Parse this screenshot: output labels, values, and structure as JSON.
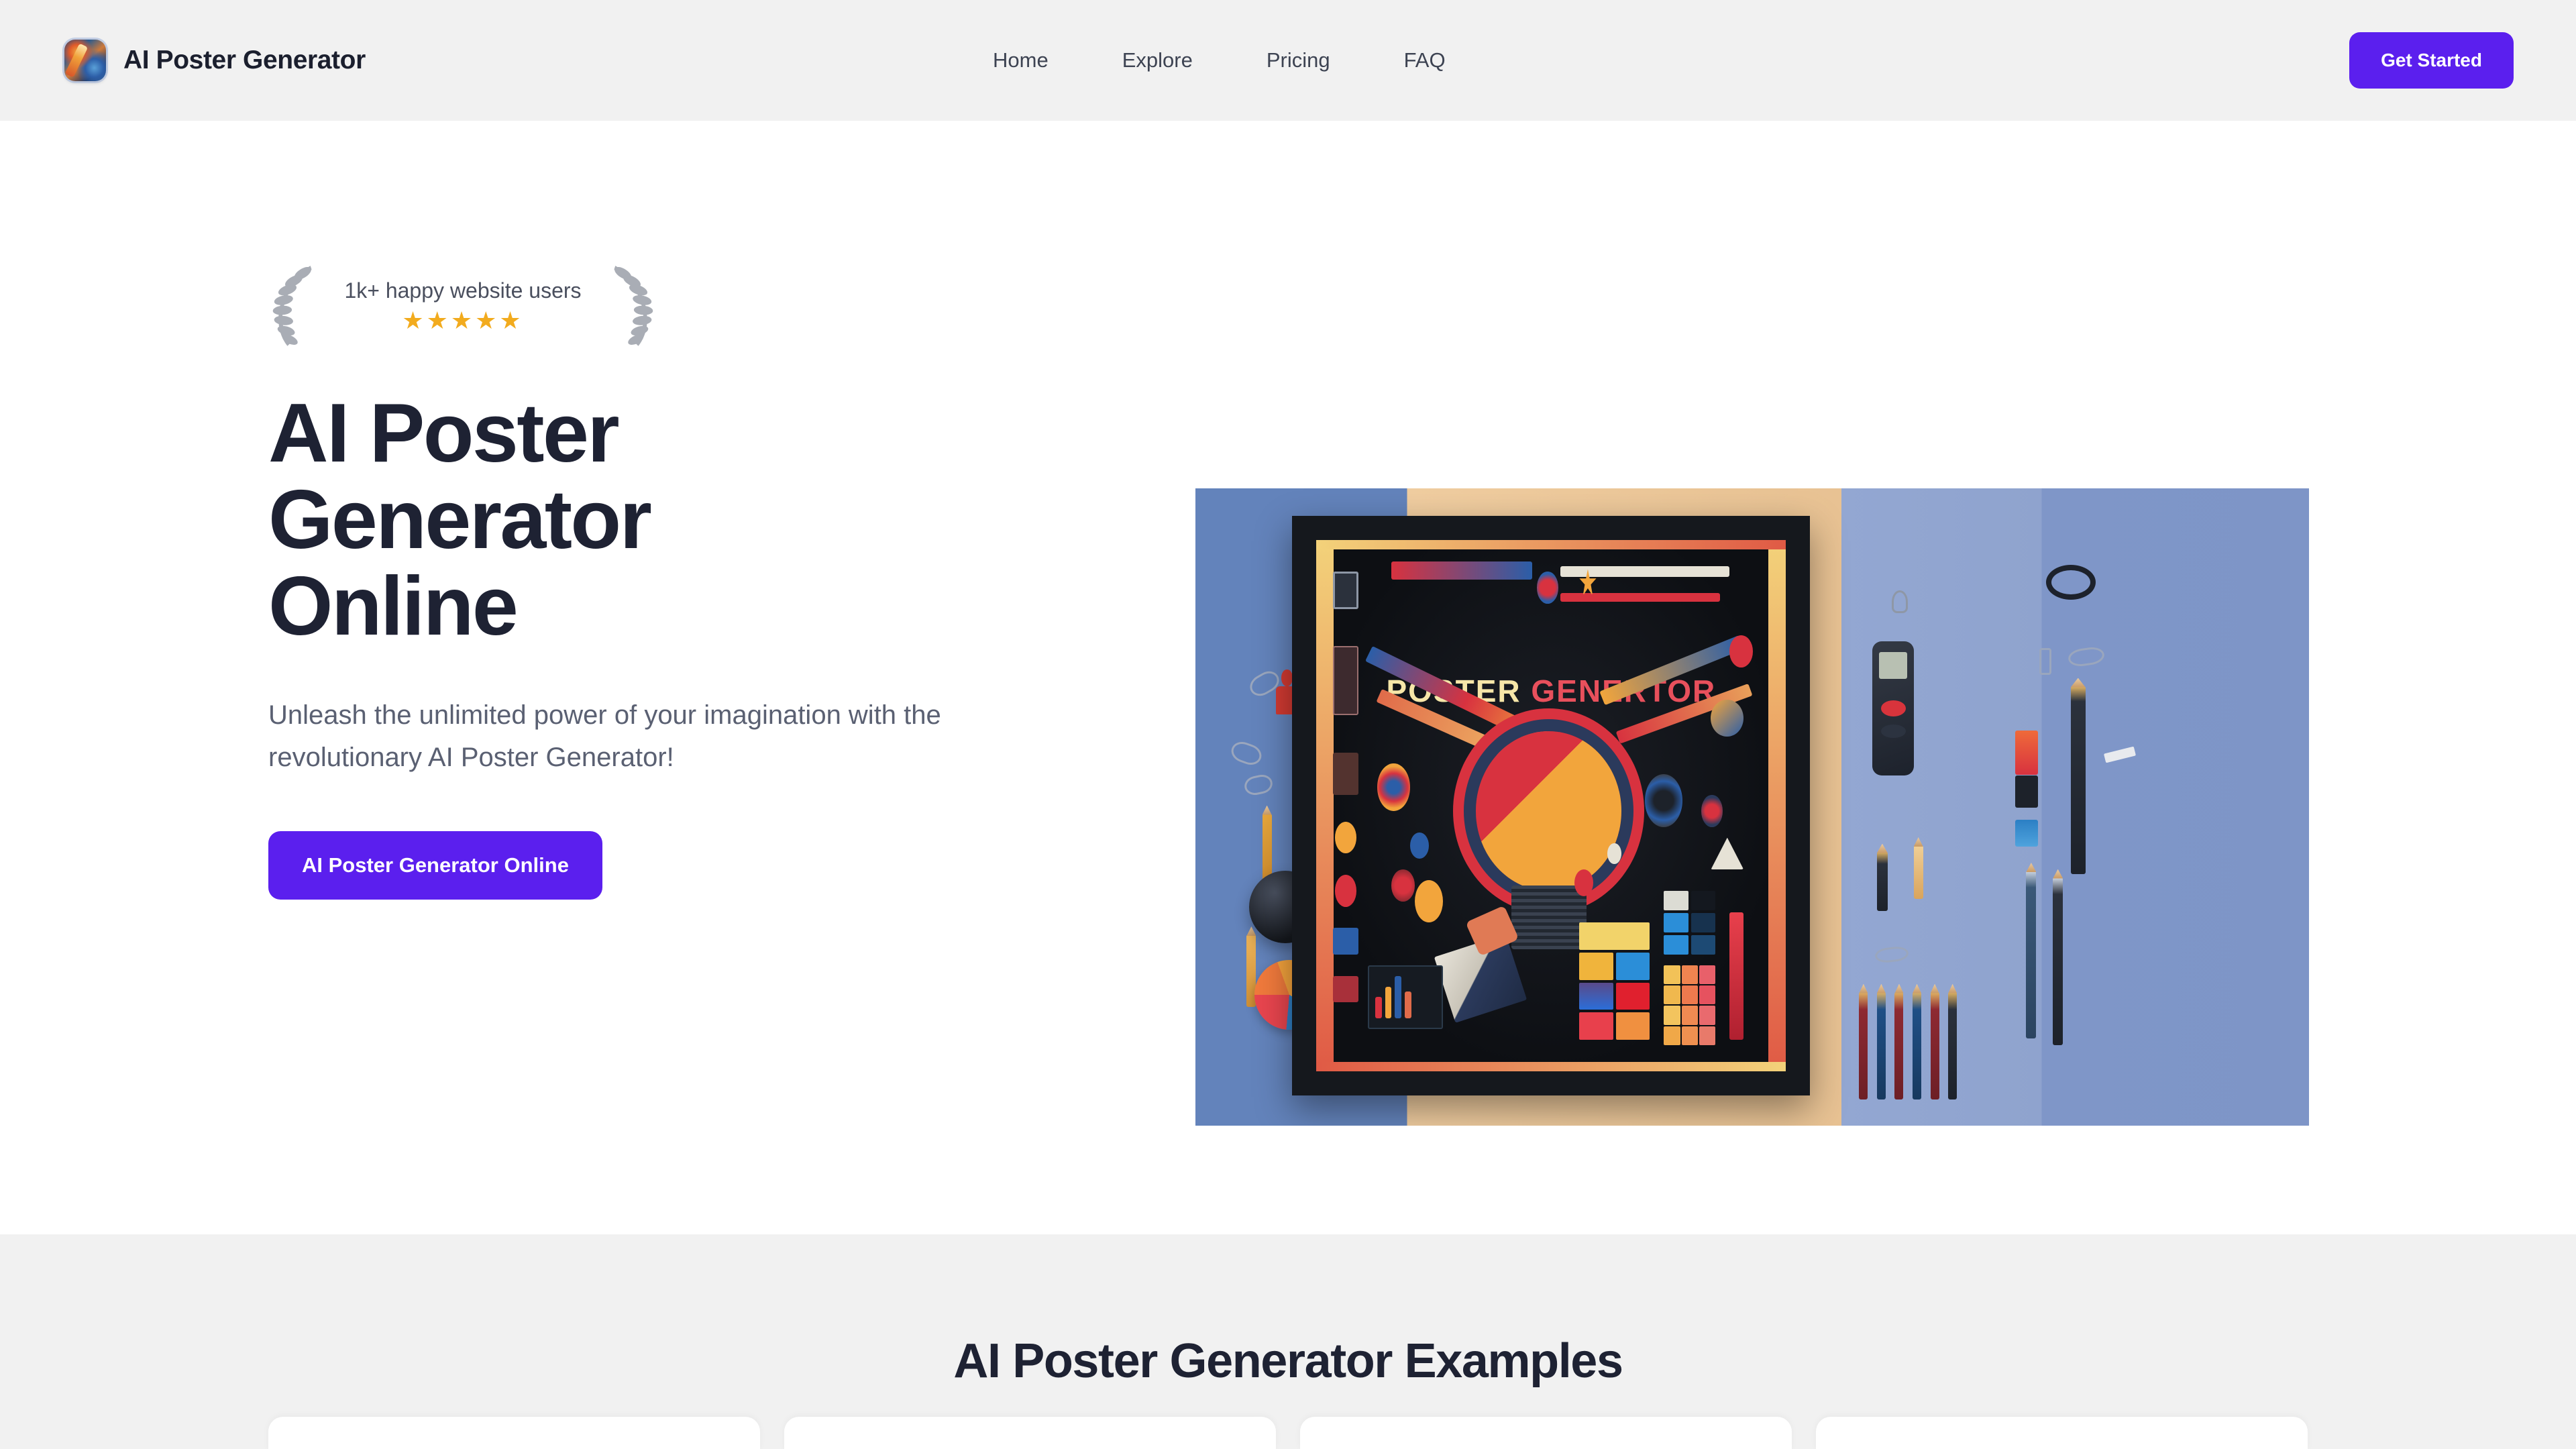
{
  "header": {
    "brand_name": "AI Poster Generator",
    "logo_icon": "app-logo-icon",
    "nav": [
      {
        "label": "Home"
      },
      {
        "label": "Explore"
      },
      {
        "label": "Pricing"
      },
      {
        "label": "FAQ"
      }
    ],
    "get_started_label": "Get Started"
  },
  "hero": {
    "social_proof": {
      "text": "1k+ happy website users",
      "stars": "★★★★★",
      "star_count": 5,
      "left_icon": "laurel-wreath-left-icon",
      "right_icon": "laurel-wreath-right-icon"
    },
    "title": "AI Poster Generator Online",
    "subtitle": "Unleash the unlimited power of your imagination with the revolutionary AI Poster Generator!",
    "cta_label": "AI Poster Generator Online",
    "image": {
      "alt": "Flat-lay of a framed colorful poster surrounded by pencils, clips and design tools",
      "poster_headline_part1": "POSTER",
      "poster_headline_part2": "GENERTOR"
    }
  },
  "examples": {
    "title": "AI Poster Generator Examples",
    "cards": [
      {
        "id": "example-card-1"
      },
      {
        "id": "example-card-2"
      },
      {
        "id": "example-card-3"
      },
      {
        "id": "example-card-4"
      }
    ]
  },
  "colors": {
    "accent_purple": "#5b1fee",
    "header_bg": "#f1f1f1",
    "heading_navy": "#1e2233",
    "body_text": "#5a6072",
    "star_gold": "#f2ab1e",
    "laurel_gray": "#a9adb5"
  }
}
